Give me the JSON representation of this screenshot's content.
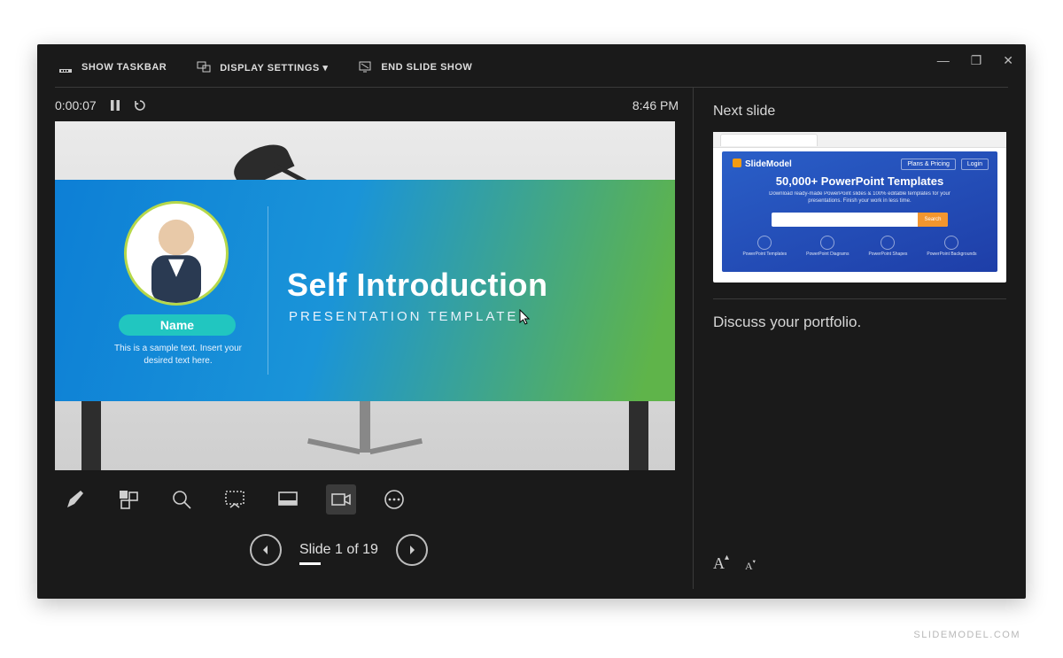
{
  "toolbar": {
    "show_taskbar": "SHOW TASKBAR",
    "display_settings": "DISPLAY SETTINGS ▾",
    "end_show": "END SLIDE SHOW"
  },
  "timer": {
    "elapsed": "0:00:07",
    "clock": "8:46 PM"
  },
  "slide": {
    "title": "Self Introduction",
    "subtitle": "PRESENTATION TEMPLATE",
    "name_label": "Name",
    "sample_text": "This is a sample text. Insert your desired text here."
  },
  "nav": {
    "counter": "Slide 1 of 19"
  },
  "right": {
    "next_label": "Next slide",
    "notes": "Discuss your portfolio.",
    "thumb": {
      "logo": "SlideModel",
      "headline": "50,000+ PowerPoint Templates",
      "sub": "Download ready-made PowerPoint slides & 100% editable templates for your presentations. Finish your work in less time.",
      "search_btn": "Search",
      "plans": "Plans & Pricing",
      "login": "Login",
      "cat1": "PowerPoint Templates",
      "cat2": "PowerPoint Diagrams",
      "cat3": "PowerPoint Shapes",
      "cat4": "PowerPoint Backgrounds"
    }
  },
  "attribution": "SLIDEMODEL.COM"
}
